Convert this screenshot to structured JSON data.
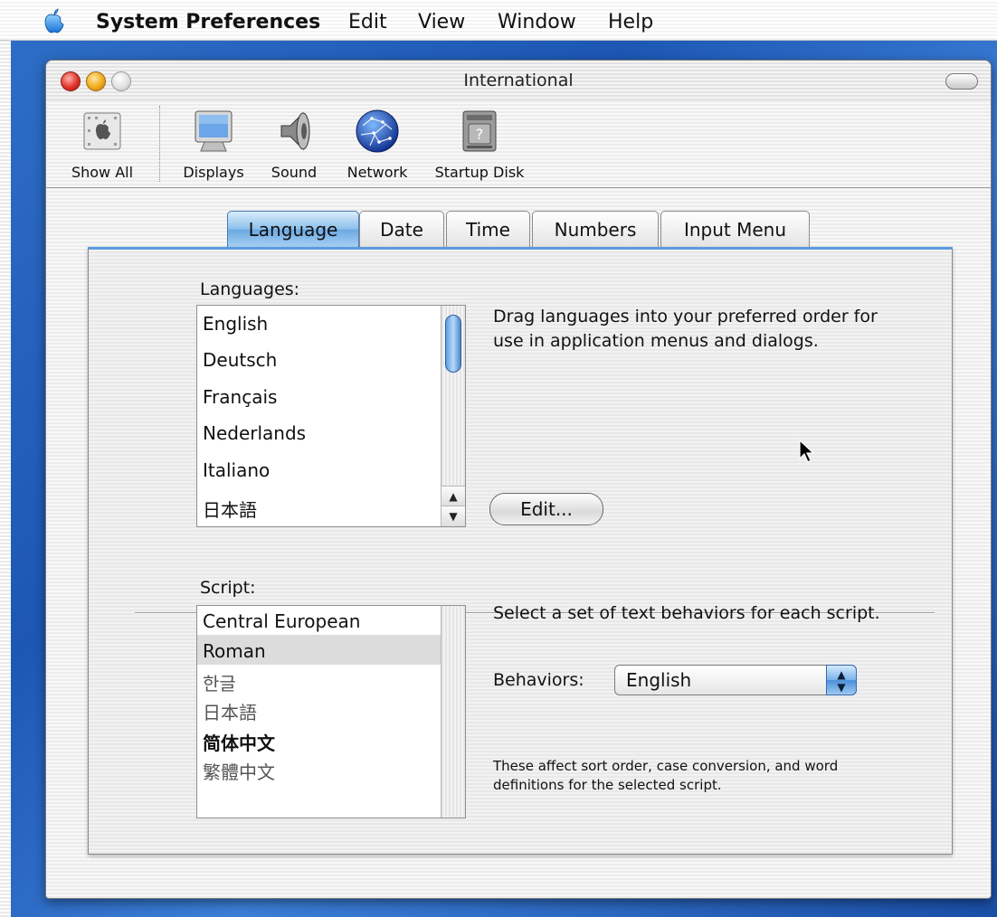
{
  "menubar": {
    "app_name": "System Preferences",
    "items": [
      "Edit",
      "View",
      "Window",
      "Help"
    ]
  },
  "window": {
    "title": "International"
  },
  "toolbar": {
    "items": [
      {
        "label": "Show All",
        "icon": "show-all-icon"
      },
      {
        "label": "Displays",
        "icon": "displays-icon"
      },
      {
        "label": "Sound",
        "icon": "sound-icon"
      },
      {
        "label": "Network",
        "icon": "network-icon"
      },
      {
        "label": "Startup Disk",
        "icon": "startup-disk-icon"
      }
    ]
  },
  "tabs": [
    {
      "label": "Language",
      "selected": true
    },
    {
      "label": "Date",
      "selected": false
    },
    {
      "label": "Time",
      "selected": false
    },
    {
      "label": "Numbers",
      "selected": false
    },
    {
      "label": "Input Menu",
      "selected": false
    }
  ],
  "languages": {
    "heading": "Languages:",
    "items": [
      "English",
      "Deutsch",
      "Français",
      "Nederlands",
      "Italiano",
      "日本語"
    ],
    "description": "Drag languages into your preferred order for use in application menus and dialogs.",
    "edit_button": "Edit..."
  },
  "script": {
    "heading": "Script:",
    "items": [
      "Central European",
      "Roman",
      "한글",
      "日本語",
      "简体中文",
      "繁體中文"
    ],
    "selected": "Roman",
    "description": "Select a set of text behaviors for each script.",
    "behaviors_label": "Behaviors:",
    "behaviors_value": "English",
    "note": "These affect sort order, case conversion, and word definitions for the selected script."
  },
  "colors": {
    "desktop": "#1d57b4",
    "selected_tab": "#6ba8e2",
    "selected_row": "#dcdcdc"
  }
}
